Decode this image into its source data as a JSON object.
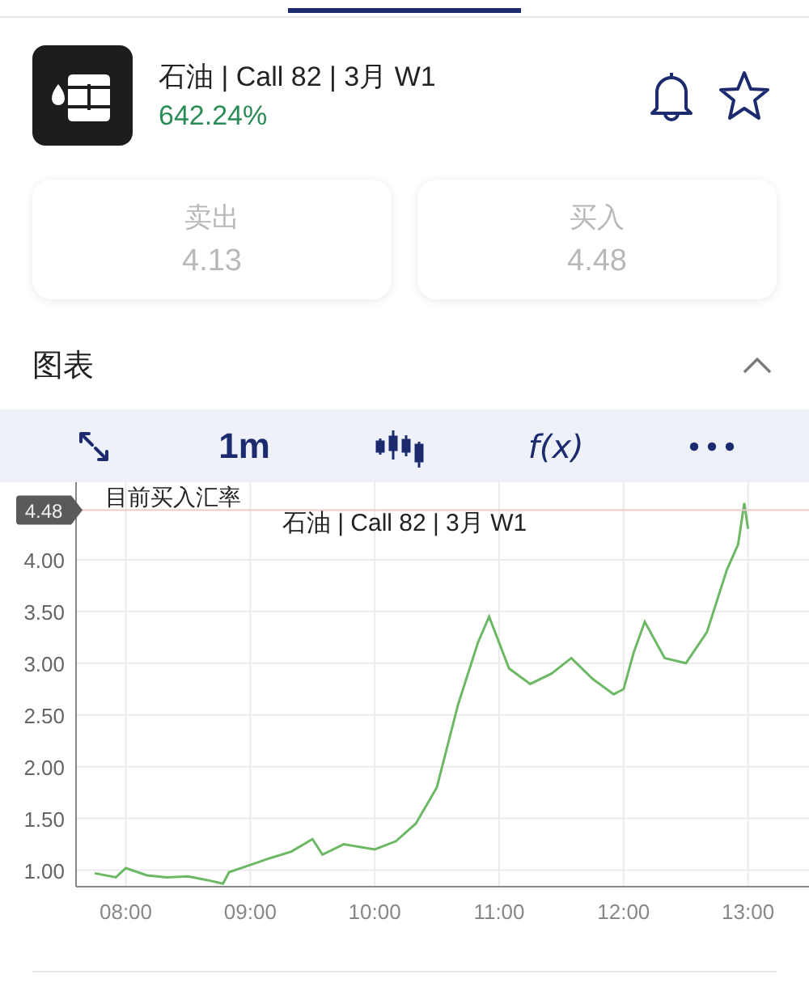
{
  "header": {
    "title": "石油 | Call 82 | 3月 W1",
    "change": "642.24%"
  },
  "quotes": [
    {
      "label": "卖出",
      "value": "4.13"
    },
    {
      "label": "买入",
      "value": "4.48"
    }
  ],
  "section": {
    "title": "图表",
    "expanded": true
  },
  "toolbar": [
    {
      "kind": "expand"
    },
    {
      "kind": "text",
      "label": "1m"
    },
    {
      "kind": "candles"
    },
    {
      "kind": "italic",
      "label": "f(x)"
    },
    {
      "kind": "more"
    }
  ],
  "chart": {
    "chart_data": {
      "type": "line",
      "title": "石油 | Call 82 | 3月 W1",
      "x": [
        7.75,
        7.92,
        8.0,
        8.17,
        8.33,
        8.5,
        8.67,
        8.78,
        8.83,
        9.0,
        9.17,
        9.33,
        9.5,
        9.58,
        9.75,
        10.0,
        10.17,
        10.33,
        10.5,
        10.67,
        10.83,
        10.92,
        11.08,
        11.25,
        11.42,
        11.58,
        11.75,
        11.92,
        12.0,
        12.08,
        12.17,
        12.33,
        12.5,
        12.67,
        12.83,
        12.92,
        12.97,
        13.0
      ],
      "series": [
        {
          "color": "#6cb864",
          "values": [
            0.97,
            0.93,
            1.02,
            0.95,
            0.93,
            0.94,
            0.9,
            0.87,
            0.98,
            1.05,
            1.12,
            1.18,
            1.3,
            1.15,
            1.25,
            1.2,
            1.28,
            1.45,
            1.8,
            2.6,
            3.2,
            3.45,
            2.95,
            2.8,
            2.9,
            3.05,
            2.85,
            2.7,
            2.75,
            3.1,
            3.4,
            3.05,
            3.0,
            3.3,
            3.9,
            4.15,
            4.55,
            4.3
          ]
        }
      ],
      "xlim": [
        7.6,
        13.49
      ],
      "ylim": [
        0.84,
        4.75
      ],
      "xticks": [
        {
          "value": 8,
          "label": "08:00"
        },
        {
          "value": 9,
          "label": "09:00"
        },
        {
          "value": 10,
          "label": "10:00"
        },
        {
          "value": 11,
          "label": "11:00"
        },
        {
          "value": 12,
          "label": "12:00"
        },
        {
          "value": 13,
          "label": "13:00"
        }
      ],
      "yticks": [
        {
          "value": 1,
          "label": "1.00"
        },
        {
          "value": 1.5,
          "label": "1.50"
        },
        {
          "value": 2,
          "label": "2.00"
        },
        {
          "value": 2.5,
          "label": "2.50"
        },
        {
          "value": 3,
          "label": "3.00"
        },
        {
          "value": 3.5,
          "label": "3.50"
        },
        {
          "value": 4,
          "label": "4.00"
        }
      ],
      "grid": true,
      "ref_lines": [
        {
          "axis": "y",
          "value": 4.48,
          "label": "4.48"
        }
      ]
    },
    "caption": "目前买入汇率"
  }
}
